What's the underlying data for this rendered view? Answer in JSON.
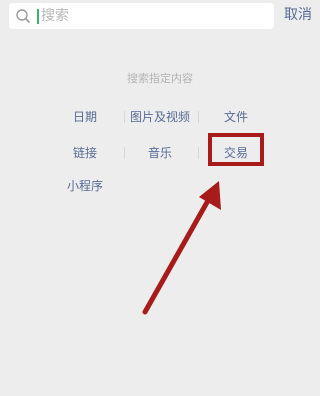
{
  "search": {
    "placeholder": "搜索",
    "cancel_label": "取消"
  },
  "section": {
    "title": "搜索指定内容"
  },
  "filters": {
    "date": "日期",
    "images_videos": "图片及视频",
    "files": "文件",
    "links": "链接",
    "music": "音乐",
    "transactions": "交易",
    "mini_programs": "小程序"
  },
  "colors": {
    "background": "#ededed",
    "link": "#576b95",
    "annotation": "#a81b1b"
  }
}
